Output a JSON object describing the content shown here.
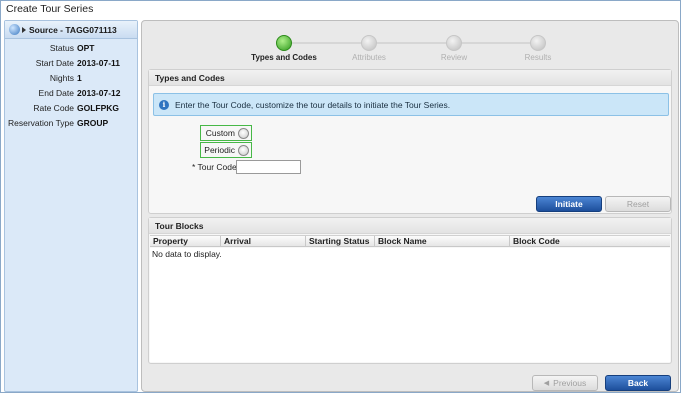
{
  "window": {
    "title": "Create Tour Series"
  },
  "sidebar": {
    "header": "Source - TAGG071113",
    "fields": [
      {
        "label": "Status",
        "value": "OPT"
      },
      {
        "label": "Start Date",
        "value": "2013-07-11"
      },
      {
        "label": "Nights",
        "value": "1"
      },
      {
        "label": "End Date",
        "value": "2013-07-12"
      },
      {
        "label": "Rate Code",
        "value": "GOLFPKG"
      },
      {
        "label": "Reservation Type",
        "value": "GROUP"
      }
    ]
  },
  "wizard": {
    "steps": [
      {
        "label": "Types and Codes",
        "active": true
      },
      {
        "label": "Attributes",
        "active": false
      },
      {
        "label": "Review",
        "active": false
      },
      {
        "label": "Results",
        "active": false
      }
    ]
  },
  "types_section": {
    "title": "Types and Codes",
    "info_text": "Enter the Tour Code, customize the tour details to initiate the Tour Series.",
    "radio_custom": "Custom",
    "radio_periodic": "Periodic",
    "tour_code_label": "* Tour Code",
    "tour_code_value": "",
    "initiate_label": "Initiate",
    "reset_label": "Reset"
  },
  "tour_blocks": {
    "title": "Tour Blocks",
    "columns": [
      "Property",
      "Arrival",
      "Starting Status",
      "Block Name",
      "Block Code"
    ],
    "empty_text": "No data to display."
  },
  "footer": {
    "previous_label": "Previous",
    "back_label": "Back"
  },
  "colors": {
    "active_step": "#2f9a1e",
    "primary_button": "#1d4f9c",
    "highlight_border": "#47b847",
    "info_bg": "#cbe6f8"
  }
}
